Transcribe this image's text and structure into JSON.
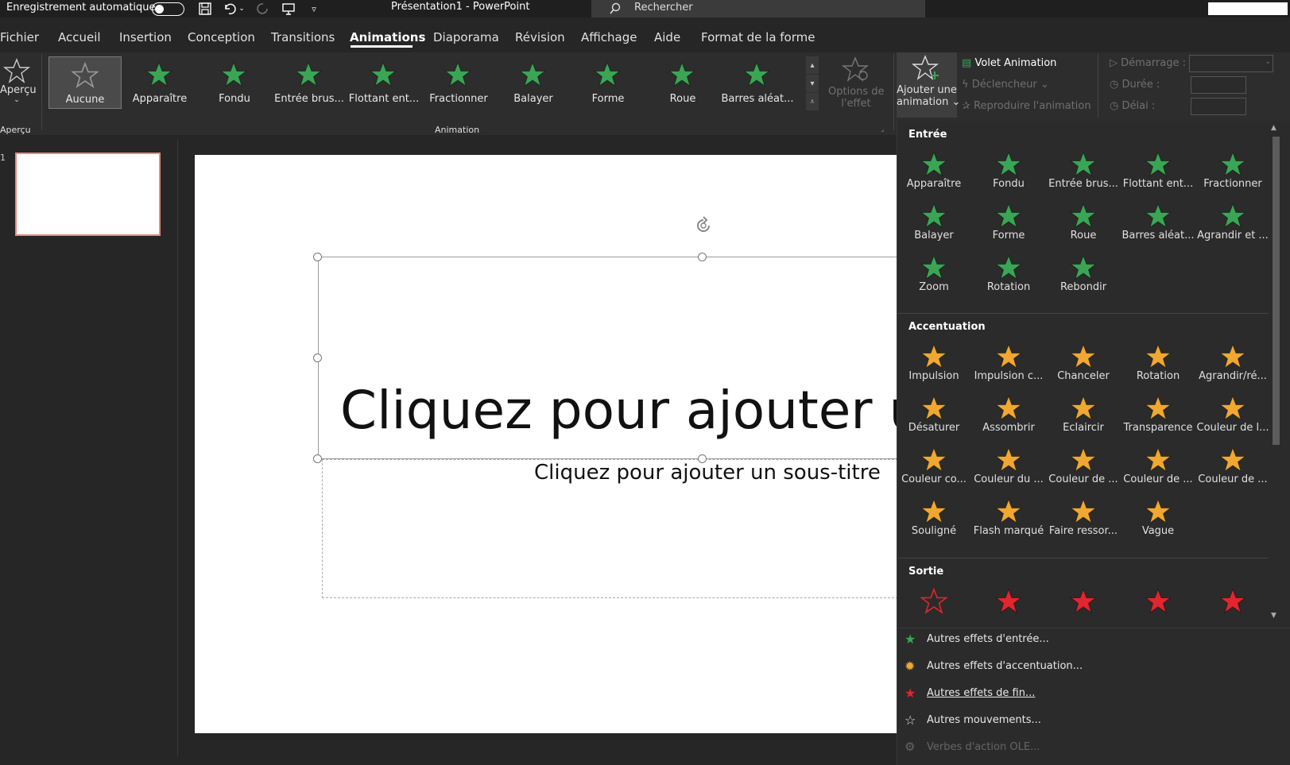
{
  "titlebar": {
    "autosave_label": "Enregistrement automatique",
    "document_title": "Présentation1  -  PowerPoint",
    "search_label": "Rechercher"
  },
  "tabs": [
    "Fichier",
    "Accueil",
    "Insertion",
    "Conception",
    "Transitions",
    "Animations",
    "Diaporama",
    "Révision",
    "Affichage",
    "Aide",
    "Format de la forme"
  ],
  "active_tab": "Animations",
  "ribbon": {
    "preview_label": "Aperçu",
    "preview_group_label": "Aperçu",
    "animation_group_label": "Animation",
    "gallery": [
      "Aucune",
      "Apparaître",
      "Fondu",
      "Entrée brus...",
      "Flottant ent...",
      "Fractionner",
      "Balayer",
      "Forme",
      "Roue",
      "Barres aléat..."
    ],
    "effect_options_label_1": "Options de",
    "effect_options_label_2": "l'effet",
    "add_animation_label_1": "Ajouter une",
    "add_animation_label_2": "animation",
    "animation_pane_label": "Volet Animation",
    "trigger_label": "Déclencheur",
    "painter_label": "Reproduire l'animation",
    "start_label": "Démarrage :",
    "duration_label": "Durée :",
    "delay_label": "Délai :"
  },
  "slide": {
    "title_placeholder": "Cliquez pour ajouter u",
    "subtitle_placeholder": "Cliquez pour ajouter un sous-titre",
    "thumb_number": "1"
  },
  "dropdown": {
    "entrance_header": "Entrée",
    "entrance": [
      "Apparaître",
      "Fondu",
      "Entrée brus...",
      "Flottant ent...",
      "Fractionner",
      "Balayer",
      "Forme",
      "Roue",
      "Barres aléat...",
      "Agrandir et ...",
      "Zoom",
      "Rotation",
      "Rebondir"
    ],
    "emphasis_header": "Accentuation",
    "emphasis": [
      "Impulsion",
      "Impulsion c...",
      "Chanceler",
      "Rotation",
      "Agrandir/ré...",
      "Désaturer",
      "Assombrir",
      "Éclaircir",
      "Transparence",
      "Couleur de l...",
      "Couleur co...",
      "Couleur du ...",
      "Couleur de ...",
      "Couleur de ...",
      "Couleur de ...",
      "Souligné",
      "Flash marqué",
      "Faire ressor...",
      "Vague"
    ],
    "exit_header": "Sortie",
    "more_entrance": "Autres effets d'entrée...",
    "more_emphasis": "Autres effets d'accentuation...",
    "more_exit": "Autres effets de fin...",
    "more_motion": "Autres mouvements...",
    "ole_verbs": "Verbes d'action OLE..."
  },
  "colors": {
    "entrance_star": "#3aa655",
    "emphasis_star": "#f0a830",
    "exit_star": "#e0262e",
    "selected_outline": "#e68a7a"
  }
}
